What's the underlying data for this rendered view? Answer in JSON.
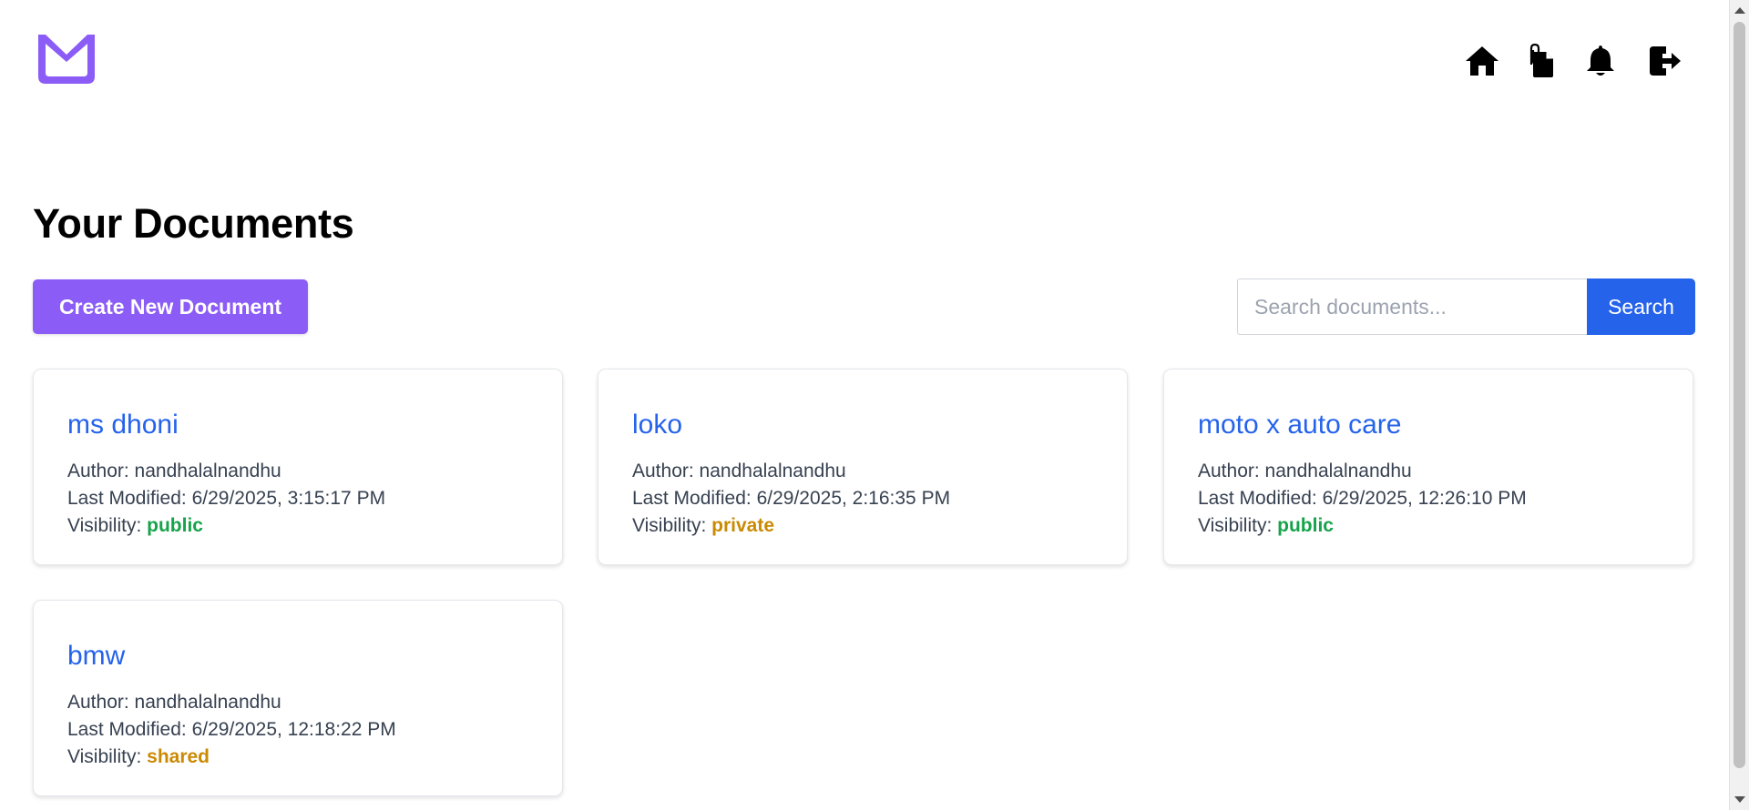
{
  "header": {
    "logo_icon": "book-logo-icon",
    "nav": [
      {
        "name": "home",
        "icon": "home-icon"
      },
      {
        "name": "documents",
        "icon": "documents-icon"
      },
      {
        "name": "notifications",
        "icon": "bell-icon"
      },
      {
        "name": "logout",
        "icon": "logout-icon"
      }
    ]
  },
  "main": {
    "title": "Your Documents",
    "create_label": "Create New Document",
    "search": {
      "placeholder": "Search documents...",
      "value": "",
      "button_label": "Search"
    }
  },
  "documents": [
    {
      "title": "ms dhoni",
      "author_label": "Author: ",
      "author": "nandhalalnandhu",
      "modified_label": "Last Modified: ",
      "modified": "6/29/2025, 3:15:17 PM",
      "visibility_label": "Visibility: ",
      "visibility": "public"
    },
    {
      "title": "loko",
      "author_label": "Author: ",
      "author": "nandhalalnandhu",
      "modified_label": "Last Modified: ",
      "modified": "6/29/2025, 2:16:35 PM",
      "visibility_label": "Visibility: ",
      "visibility": "private"
    },
    {
      "title": "moto x auto care",
      "author_label": "Author: ",
      "author": "nandhalalnandhu",
      "modified_label": "Last Modified: ",
      "modified": "6/29/2025, 12:26:10 PM",
      "visibility_label": "Visibility: ",
      "visibility": "public"
    },
    {
      "title": "bmw",
      "author_label": "Author: ",
      "author": "nandhalalnandhu",
      "modified_label": "Last Modified: ",
      "modified": "6/29/2025, 12:18:22 PM",
      "visibility_label": "Visibility: ",
      "visibility": "shared"
    }
  ],
  "colors": {
    "brand": "#8b5cf6",
    "link": "#2563eb",
    "search_button": "#2563eb",
    "visibility_public": "#16a34a",
    "visibility_private": "#ca8a04",
    "visibility_shared": "#ca8a04"
  }
}
